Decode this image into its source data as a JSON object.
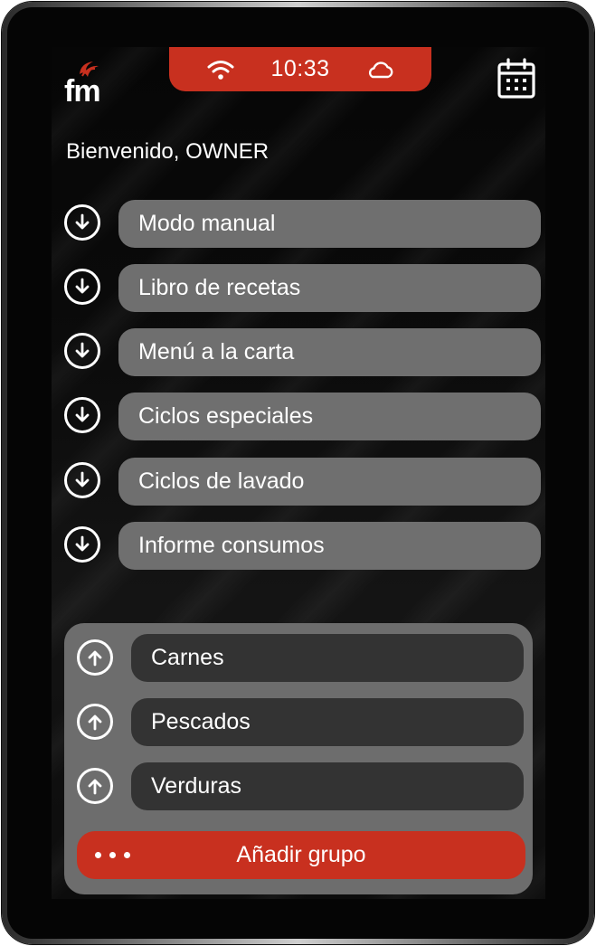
{
  "status": {
    "time": "10:33",
    "wifi_icon": "wifi-icon",
    "cloud_icon": "cloud-icon"
  },
  "brand": {
    "logo_text": "fm"
  },
  "header": {
    "welcome": "Bienvenido, OWNER",
    "calendar_icon": "calendar-icon"
  },
  "menu": [
    {
      "label": "Modo manual",
      "icon": "arrow-down-circle-icon"
    },
    {
      "label": "Libro de recetas",
      "icon": "arrow-down-circle-icon"
    },
    {
      "label": "Menú a la carta",
      "icon": "arrow-down-circle-icon"
    },
    {
      "label": "Ciclos especiales",
      "icon": "arrow-down-circle-icon"
    },
    {
      "label": "Ciclos de lavado",
      "icon": "arrow-down-circle-icon"
    },
    {
      "label": "Informe consumos",
      "icon": "arrow-down-circle-icon"
    }
  ],
  "groups": [
    {
      "label": "Carnes",
      "icon": "arrow-up-circle-icon"
    },
    {
      "label": "Pescados",
      "icon": "arrow-up-circle-icon"
    },
    {
      "label": "Verduras",
      "icon": "arrow-up-circle-icon"
    }
  ],
  "add_group": {
    "label": "Añadir grupo",
    "icon": "more-dots-icon"
  },
  "colors": {
    "accent": "#c8301f",
    "pill": "#6f6f6f",
    "group_pill": "#333333",
    "panel": "#6d6d6d"
  }
}
